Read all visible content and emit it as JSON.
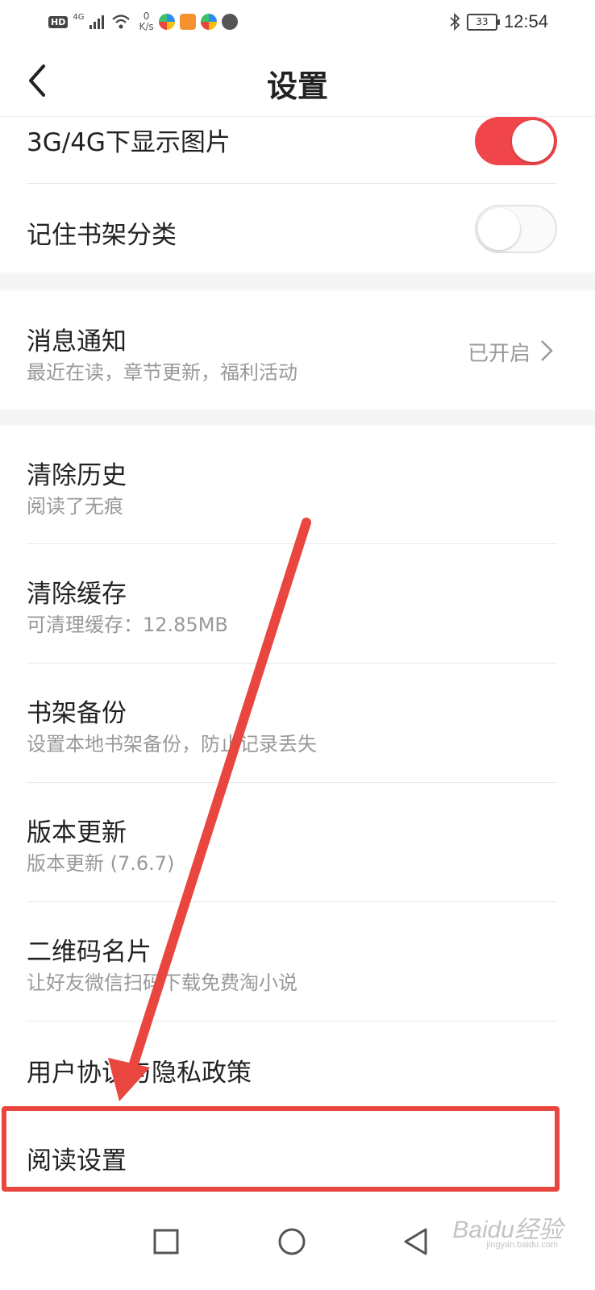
{
  "status_bar": {
    "hd": "HD",
    "net": "4G",
    "speed_value": "0",
    "speed_unit": "K/s",
    "battery": "33",
    "time": "12:54"
  },
  "header": {
    "title": "设置"
  },
  "settings": {
    "show_images": {
      "label": "3G/4G下显示图片",
      "enabled": true
    },
    "remember_shelf": {
      "label": "记住书架分类",
      "enabled": false
    },
    "notifications": {
      "label": "消息通知",
      "subtitle": "最近在读，章节更新，福利活动",
      "value": "已开启"
    },
    "clear_history": {
      "label": "清除历史",
      "subtitle": "阅读了无痕"
    },
    "clear_cache": {
      "label": "清除缓存",
      "subtitle": "可清理缓存：12.85MB"
    },
    "shelf_backup": {
      "label": "书架备份",
      "subtitle": "设置本地书架备份，防止记录丢失"
    },
    "version_update": {
      "label": "版本更新",
      "subtitle": "版本更新 (7.6.7)"
    },
    "qr_card": {
      "label": "二维码名片",
      "subtitle": "让好友微信扫码下载免费淘小说"
    },
    "agreement": {
      "label": "用户协议与隐私政策"
    },
    "reading_settings": {
      "label": "阅读设置"
    }
  },
  "watermark": {
    "brand": "Baidu经验",
    "url": "jingyan.baidu.com"
  },
  "colors": {
    "accent": "#f0454b",
    "annotation": "#e8463f"
  }
}
